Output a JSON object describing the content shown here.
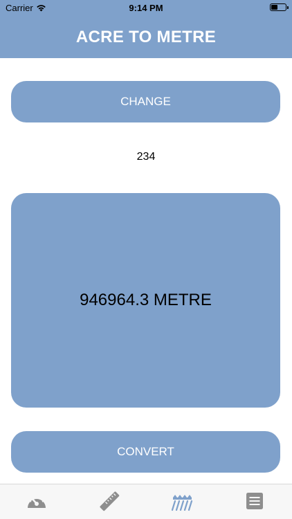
{
  "status_bar": {
    "carrier": "Carrier",
    "time": "9:14 PM"
  },
  "header": {
    "title": "ACRE TO METRE"
  },
  "buttons": {
    "change_label": "CHANGE",
    "convert_label": "CONVERT"
  },
  "input": {
    "value": "234"
  },
  "result": {
    "text": "946964.3 METRE"
  },
  "tabbar": {
    "items": [
      {
        "icon": "speedometer-icon",
        "active": false
      },
      {
        "icon": "ruler-icon",
        "active": false
      },
      {
        "icon": "field-icon",
        "active": true
      },
      {
        "icon": "menu-icon",
        "active": false
      }
    ]
  },
  "colors": {
    "accent": "#7fa1cb",
    "tab_inactive": "#8e8e8e",
    "tab_active": "#7fa1cb"
  }
}
